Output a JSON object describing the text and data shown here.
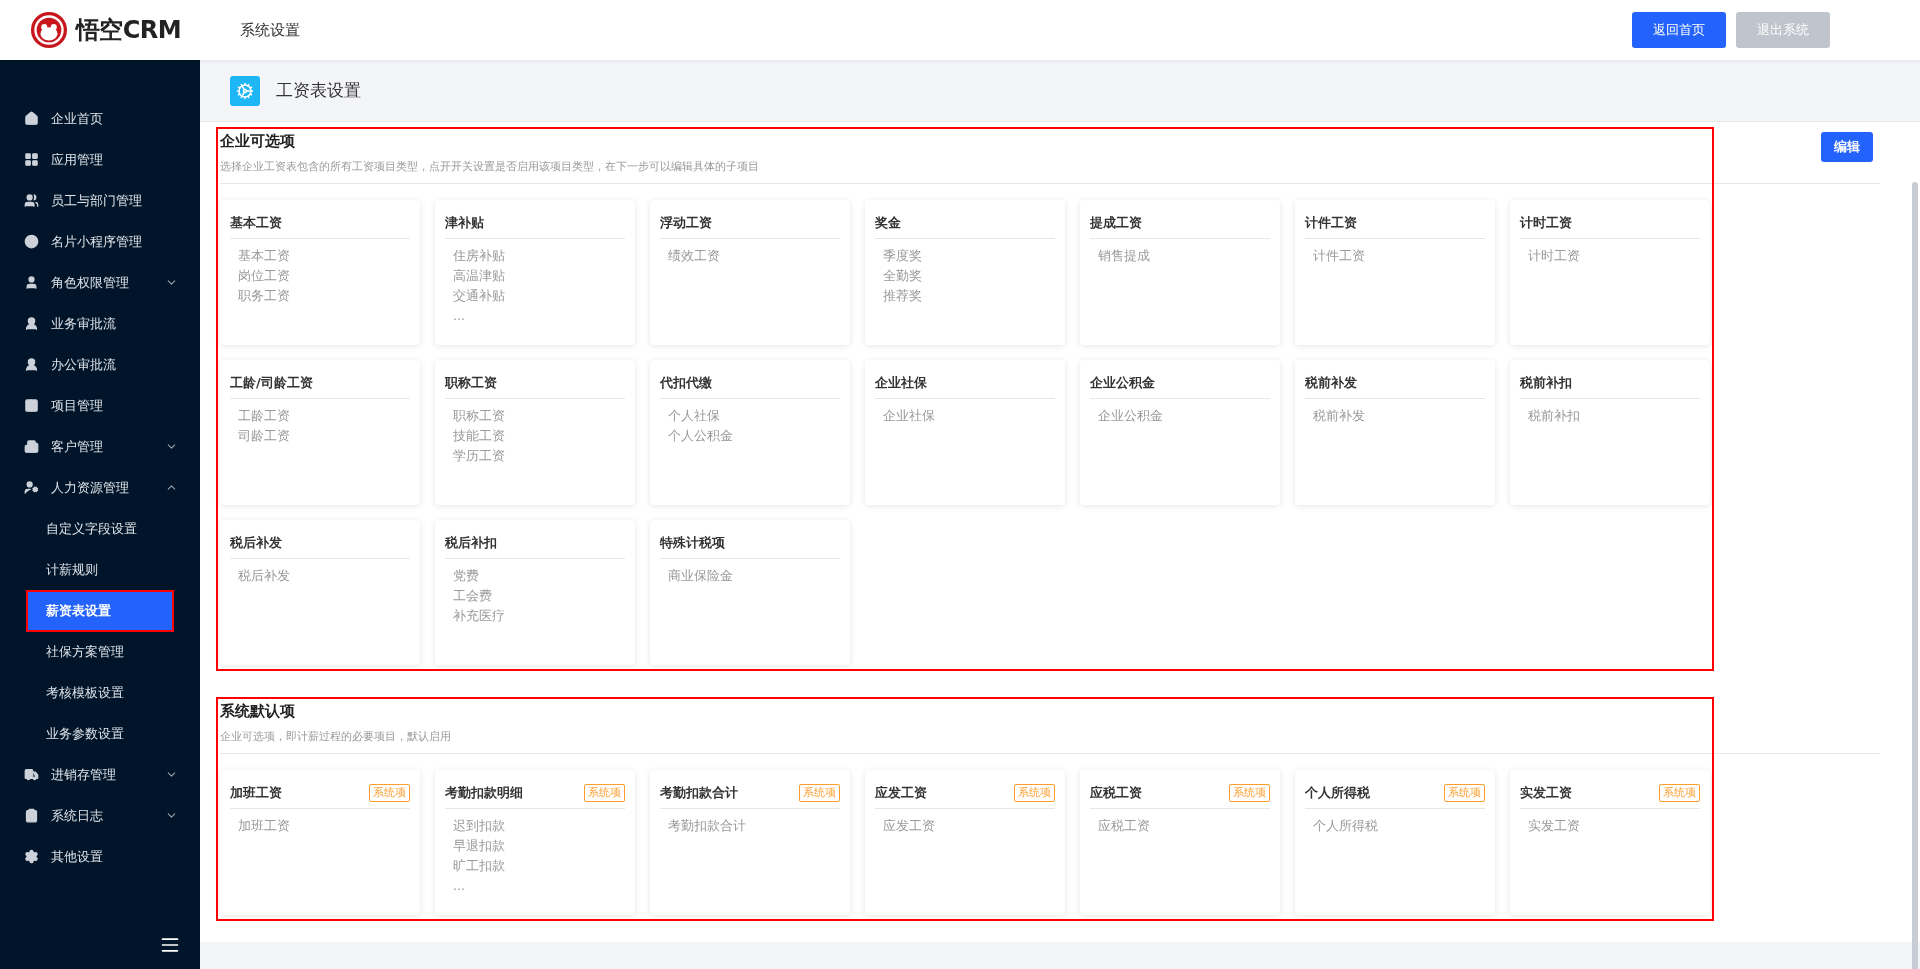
{
  "header": {
    "logo_text": "悟空CRM",
    "title": "系统设置",
    "buttons": [
      {
        "label": "返回首页",
        "kind": "primary"
      },
      {
        "label": "退出系统",
        "kind": "muted"
      }
    ]
  },
  "sidebar": {
    "items": [
      {
        "label": "企业首页",
        "kind": "link"
      },
      {
        "label": "应用管理",
        "kind": "link"
      },
      {
        "label": "员工与部门管理",
        "kind": "link"
      },
      {
        "label": "名片小程序管理",
        "kind": "link"
      },
      {
        "label": "角色权限管理",
        "kind": "group",
        "expanded": false
      },
      {
        "label": "业务审批流",
        "kind": "link"
      },
      {
        "label": "办公审批流",
        "kind": "link"
      },
      {
        "label": "项目管理",
        "kind": "link"
      },
      {
        "label": "客户管理",
        "kind": "group",
        "expanded": false
      },
      {
        "label": "人力资源管理",
        "kind": "group",
        "expanded": true,
        "children": [
          {
            "label": "自定义字段设置",
            "selected": false,
            "annotated": false
          },
          {
            "label": "计薪规则",
            "selected": false,
            "annotated": false
          },
          {
            "label": "薪资表设置",
            "selected": true,
            "annotated": true
          },
          {
            "label": "社保方案管理",
            "selected": false,
            "annotated": false
          },
          {
            "label": "考核模板设置",
            "selected": false,
            "annotated": false
          },
          {
            "label": "业务参数设置",
            "selected": false,
            "annotated": false
          }
        ]
      },
      {
        "label": "进销存管理",
        "kind": "group",
        "expanded": false
      },
      {
        "label": "系统日志",
        "kind": "group",
        "expanded": false
      },
      {
        "label": "其他设置",
        "kind": "link"
      }
    ]
  },
  "page": {
    "title": "工资表设置",
    "edit_button": "编辑"
  },
  "sections": [
    {
      "title": "企业可选项",
      "description": "选择企业工资表包含的所有工资项目类型，点开开关设置是否启用该项目类型，在下一步可以编辑具体的子项目",
      "annotated": true,
      "cards": [
        {
          "title": "基本工资",
          "items": [
            "基本工资",
            "岗位工资",
            "职务工资"
          ]
        },
        {
          "title": "津补贴",
          "items": [
            "住房补贴",
            "高温津贴",
            "交通补贴",
            "..."
          ]
        },
        {
          "title": "浮动工资",
          "items": [
            "绩效工资"
          ]
        },
        {
          "title": "奖金",
          "items": [
            "季度奖",
            "全勤奖",
            "推荐奖"
          ]
        },
        {
          "title": "提成工资",
          "items": [
            "销售提成"
          ]
        },
        {
          "title": "计件工资",
          "items": [
            "计件工资"
          ]
        },
        {
          "title": "计时工资",
          "items": [
            "计时工资"
          ]
        },
        {
          "title": "工龄/司龄工资",
          "items": [
            "工龄工资",
            "司龄工资"
          ]
        },
        {
          "title": "职称工资",
          "items": [
            "职称工资",
            "技能工资",
            "学历工资"
          ]
        },
        {
          "title": "代扣代缴",
          "items": [
            "个人社保",
            "个人公积金"
          ]
        },
        {
          "title": "企业社保",
          "items": [
            "企业社保"
          ]
        },
        {
          "title": "企业公积金",
          "items": [
            "企业公积金"
          ]
        },
        {
          "title": "税前补发",
          "items": [
            "税前补发"
          ]
        },
        {
          "title": "税前补扣",
          "items": [
            "税前补扣"
          ]
        },
        {
          "title": "税后补发",
          "items": [
            "税后补发"
          ]
        },
        {
          "title": "税后补扣",
          "items": [
            "党费",
            "工会费",
            "补充医疗"
          ]
        },
        {
          "title": "特殊计税项",
          "items": [
            "商业保险金"
          ]
        }
      ]
    },
    {
      "title": "系统默认项",
      "description": "企业可选项，即计薪过程的必要项目，默认启用",
      "annotated": true,
      "cards": [
        {
          "title": "加班工资",
          "tag": "系统项",
          "items": [
            "加班工资"
          ]
        },
        {
          "title": "考勤扣款明细",
          "tag": "系统项",
          "items": [
            "迟到扣款",
            "早退扣款",
            "旷工扣款",
            "..."
          ]
        },
        {
          "title": "考勤扣款合计",
          "tag": "系统项",
          "items": [
            "考勤扣款合计"
          ]
        },
        {
          "title": "应发工资",
          "tag": "系统项",
          "items": [
            "应发工资"
          ]
        },
        {
          "title": "应税工资",
          "tag": "系统项",
          "items": [
            "应税工资"
          ]
        },
        {
          "title": "个人所得税",
          "tag": "系统项",
          "items": [
            "个人所得税"
          ]
        },
        {
          "title": "实发工资",
          "tag": "系统项",
          "items": [
            "实发工资"
          ]
        }
      ]
    }
  ]
}
